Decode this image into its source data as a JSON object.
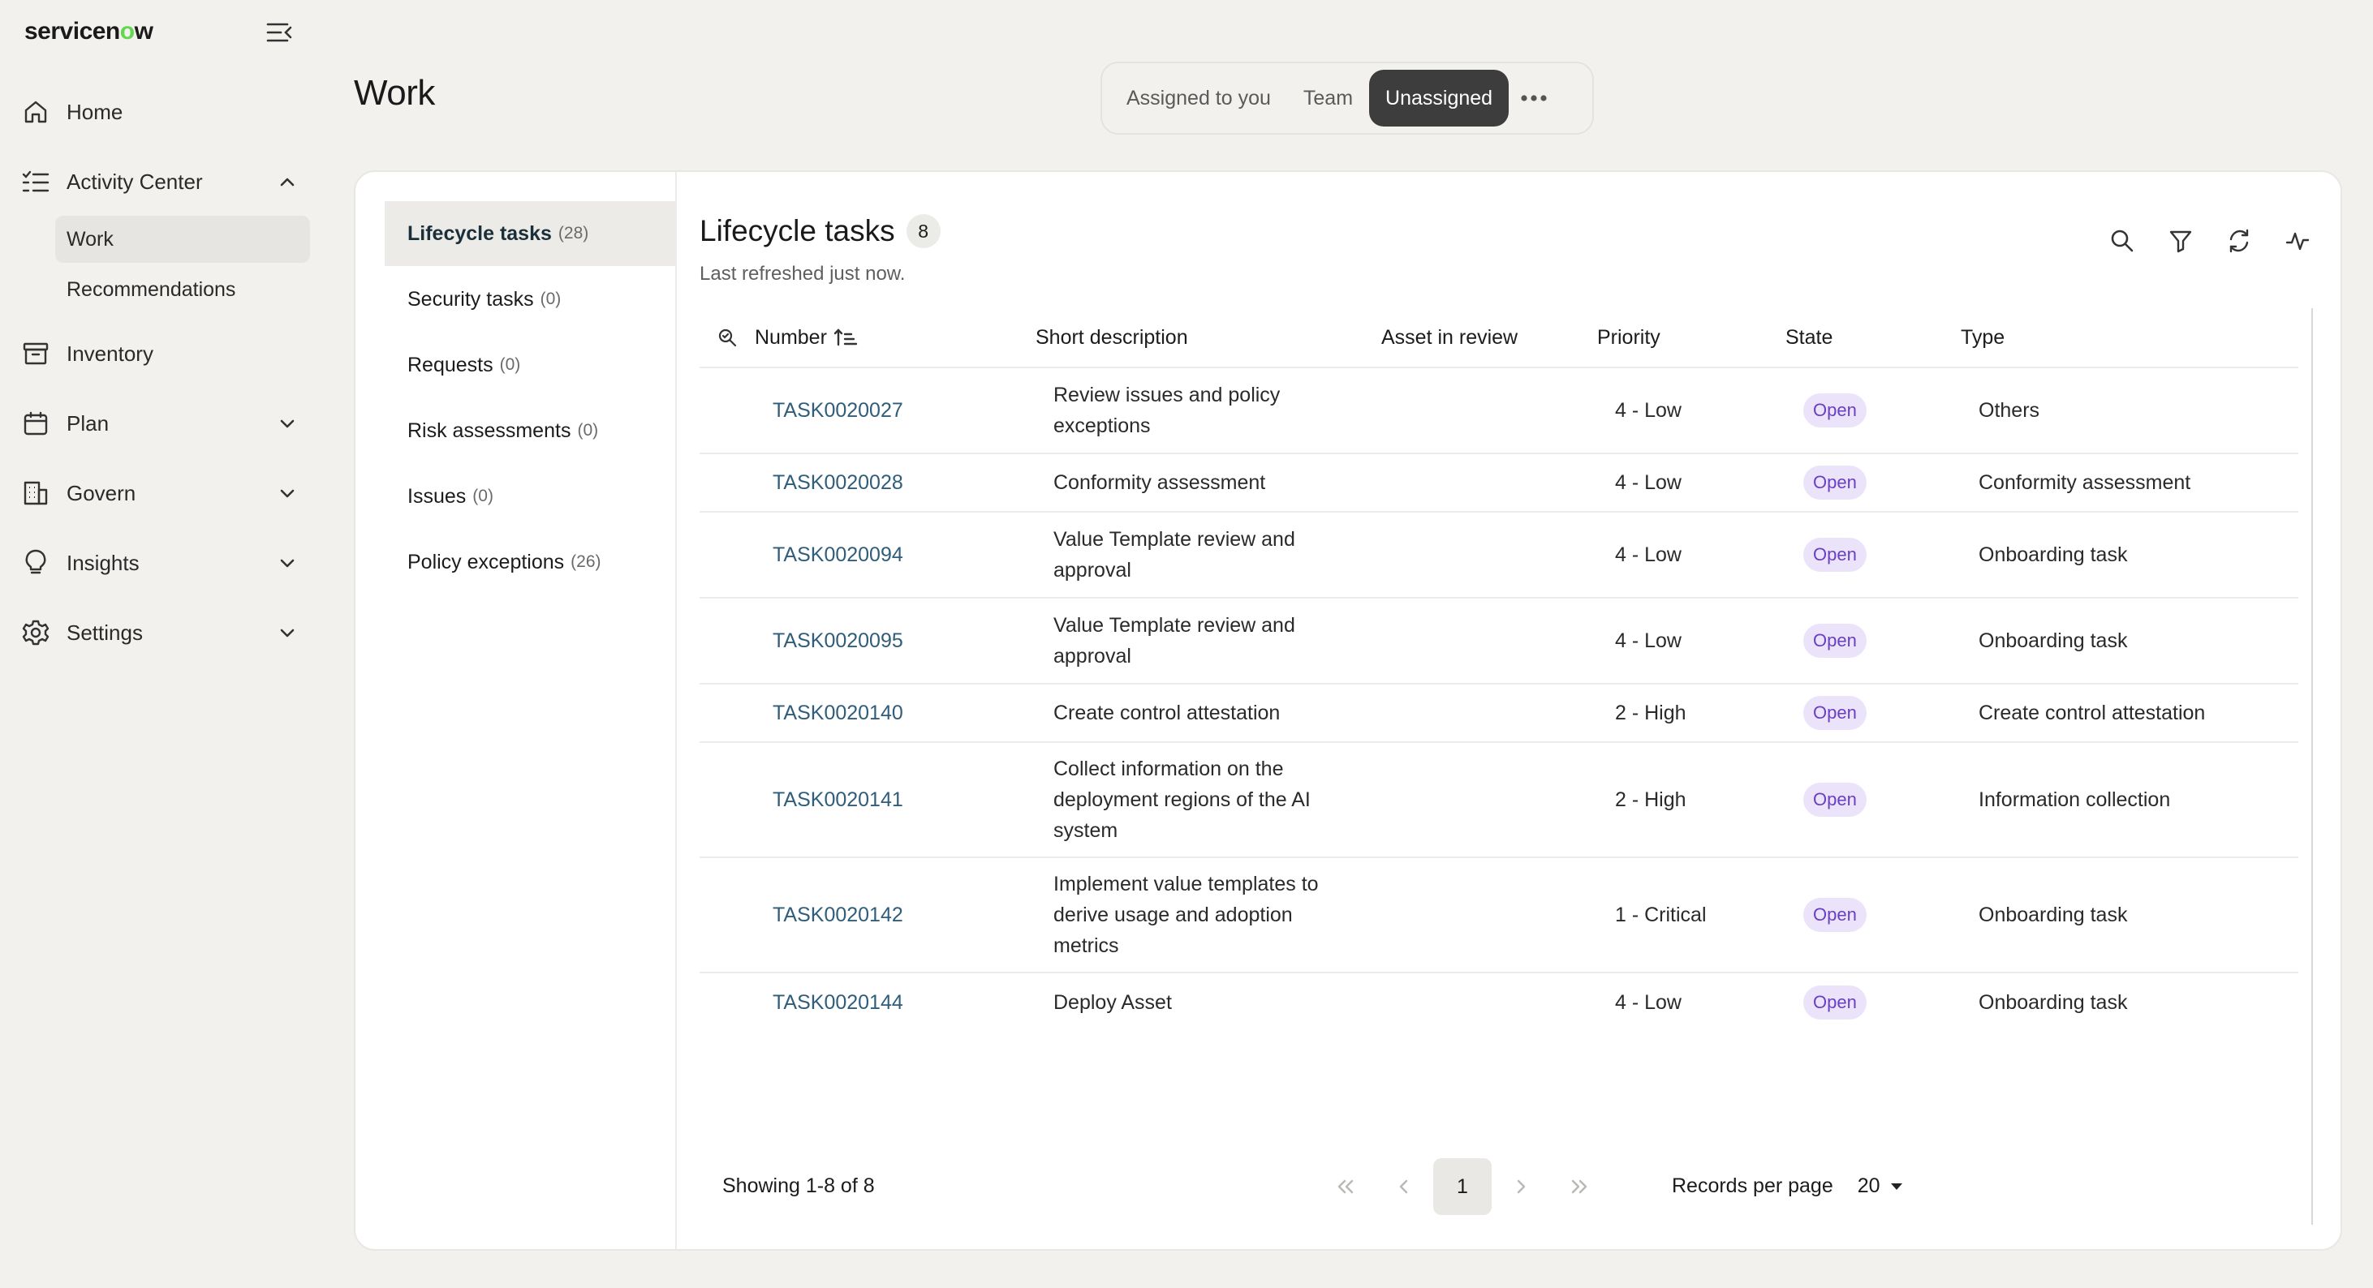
{
  "brand": {
    "logo_pre": "servicen",
    "logo_o": "o",
    "logo_post": "w"
  },
  "nav": {
    "home": "Home",
    "activity_center": "Activity Center",
    "work": "Work",
    "recommendations": "Recommendations",
    "inventory": "Inventory",
    "plan": "Plan",
    "govern": "Govern",
    "insights": "Insights",
    "settings": "Settings"
  },
  "header": {
    "title": "Work",
    "tabs": [
      "Assigned to you",
      "Team",
      "Unassigned"
    ],
    "active_tab": "Unassigned"
  },
  "categories": [
    {
      "label": "Lifecycle tasks",
      "count": "(28)"
    },
    {
      "label": "Security tasks",
      "count": "(0)"
    },
    {
      "label": "Requests",
      "count": "(0)"
    },
    {
      "label": "Risk assessments",
      "count": "(0)"
    },
    {
      "label": "Issues",
      "count": "(0)"
    },
    {
      "label": "Policy exceptions",
      "count": "(26)"
    }
  ],
  "list": {
    "title": "Lifecycle tasks",
    "count": "8",
    "refreshed": "Last refreshed just now."
  },
  "table": {
    "headers": {
      "number": "Number",
      "short_description": "Short description",
      "asset": "Asset in review",
      "priority": "Priority",
      "state": "State",
      "type": "Type"
    },
    "rows": [
      {
        "number": "TASK0020027",
        "desc": "Review issues and policy exceptions",
        "asset": "",
        "priority": "4 - Low",
        "state": "Open",
        "type": "Others"
      },
      {
        "number": "TASK0020028",
        "desc": "Conformity assessment",
        "asset": "",
        "priority": "4 - Low",
        "state": "Open",
        "type": "Conformity assessment"
      },
      {
        "number": "TASK0020094",
        "desc": "Value Template review and approval",
        "asset": "",
        "priority": "4 - Low",
        "state": "Open",
        "type": "Onboarding task"
      },
      {
        "number": "TASK0020095",
        "desc": "Value Template review and approval",
        "asset": "",
        "priority": "4 - Low",
        "state": "Open",
        "type": "Onboarding task"
      },
      {
        "number": "TASK0020140",
        "desc": "Create control attestation",
        "asset": "",
        "priority": "2 - High",
        "state": "Open",
        "type": "Create control attestation"
      },
      {
        "number": "TASK0020141",
        "desc": "Collect information on the deployment regions of the AI system",
        "asset": "",
        "priority": "2 - High",
        "state": "Open",
        "type": "Information collection"
      },
      {
        "number": "TASK0020142",
        "desc": "Implement value templates to derive usage and adoption metrics",
        "asset": "",
        "priority": "1 - Critical",
        "state": "Open",
        "type": "Onboarding task"
      },
      {
        "number": "TASK0020144",
        "desc": "Deploy Asset",
        "asset": "",
        "priority": "4 - Low",
        "state": "Open",
        "type": "Onboarding task"
      }
    ]
  },
  "footer": {
    "showing": "Showing 1-8 of 8",
    "current_page": "1",
    "records_label": "Records per page",
    "records_value": "20"
  },
  "icons": {
    "collapse": "collapse-menu-icon",
    "search": "search-icon",
    "filter": "filter-icon",
    "refresh": "refresh-icon",
    "activity": "activity-icon"
  },
  "colors": {
    "background": "#f2f1ee",
    "active_tab": "#3d3d3d",
    "link": "#2f5d7a",
    "pill_bg": "#ebe3fa",
    "pill_text": "#6a3fc4",
    "logo_accent": "#62d84e"
  }
}
